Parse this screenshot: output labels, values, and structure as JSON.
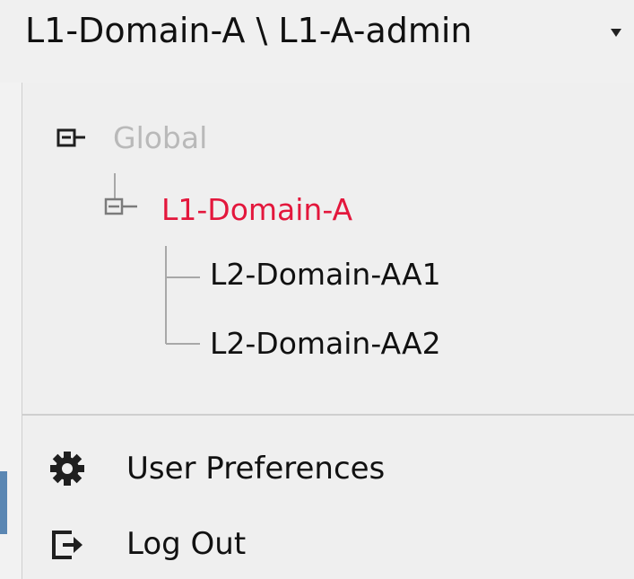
{
  "header": {
    "title": "L1-Domain-A \\ L1-A-admin",
    "caret_icon": "caret-down-icon"
  },
  "tree": {
    "global": {
      "label": "Global",
      "icon": "collapse-icon",
      "color": "#b9b9b9"
    },
    "l1": {
      "label": "L1-Domain-A",
      "icon": "collapse-icon",
      "color": "#e3173c"
    },
    "children": [
      {
        "label": "L2-Domain-AA1"
      },
      {
        "label": "L2-Domain-AA2"
      }
    ]
  },
  "menu": {
    "preferences": {
      "label": "User Preferences",
      "icon": "gear-icon"
    },
    "logout": {
      "label": "Log Out",
      "icon": "logout-icon"
    }
  }
}
